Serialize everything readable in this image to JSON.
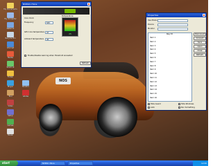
{
  "desktop": {
    "car_badge": "NOS",
    "icons": [
      {
        "label": "My Documents",
        "color": "#f2d35a"
      },
      {
        "label": "My Computer",
        "color": "#9ab8e8"
      },
      {
        "label": "Network",
        "color": "#7aa6e0"
      },
      {
        "label": "Recycle Bin",
        "color": "#c8d8e8"
      },
      {
        "label": "Internet",
        "color": "#4a8ad8"
      },
      {
        "label": "Media",
        "color": "#e85a3a"
      },
      {
        "label": "Shortcut",
        "color": "#6ac86a"
      },
      {
        "label": "Folder",
        "color": "#f0c040"
      },
      {
        "label": "Player",
        "color": "#3aa0e0"
      },
      {
        "label": "Tool",
        "color": "#d0a060"
      },
      {
        "label": "Video",
        "color": "#c04040"
      },
      {
        "label": "Setup",
        "color": "#7070d0"
      },
      {
        "label": "Games",
        "color": "#50b050"
      },
      {
        "label": "Tweak",
        "color": "#e0e0e0"
      },
      {
        "label": "Monitor",
        "color": "#90c0f0"
      },
      {
        "label": "Adobe",
        "color": "#d03030"
      }
    ]
  },
  "nvidia_window": {
    "title": "NVIDIA nTune",
    "panel_label": "Core Clock",
    "temp_box_label": "Temperature",
    "temp_value": "25",
    "rows": [
      {
        "label": "Frequency",
        "value": "525"
      },
      {
        "label": "GPU core temperature",
        "value": "47"
      },
      {
        "label": "Ambient temperature",
        "value": "40"
      }
    ],
    "checkbox_label": "Enable/disable warning when threshold exceeded",
    "button": "Refresh"
  },
  "right_window": {
    "title": "Properties",
    "fields": [
      {
        "label": "Use Model",
        "value": ""
      },
      {
        "label": "Device",
        "value": ""
      },
      {
        "label": "Monitor",
        "value": ""
      }
    ],
    "list_header": "Reg 32",
    "buttons": [
      "Disconnect",
      "Connect",
      "Save",
      "Open",
      "Close",
      "Refresh"
    ],
    "list_items": [
      "Item 1",
      "Item 2",
      "Item 3",
      "Item 4",
      "Item 5",
      "Item 6",
      "Item 7",
      "Item 8",
      "Item 9",
      "Item 10",
      "Item 11",
      "Item 12",
      "Item 13",
      "Item 14",
      "Item 15",
      "Item 16"
    ],
    "footer": [
      "Hide Guard",
      "Hide Windows",
      "Auto",
      "Run Something"
    ]
  },
  "taskbar": {
    "start": "start",
    "tasks": [
      "NVIDIA nTune",
      "Properties"
    ],
    "clock": "12:00"
  }
}
